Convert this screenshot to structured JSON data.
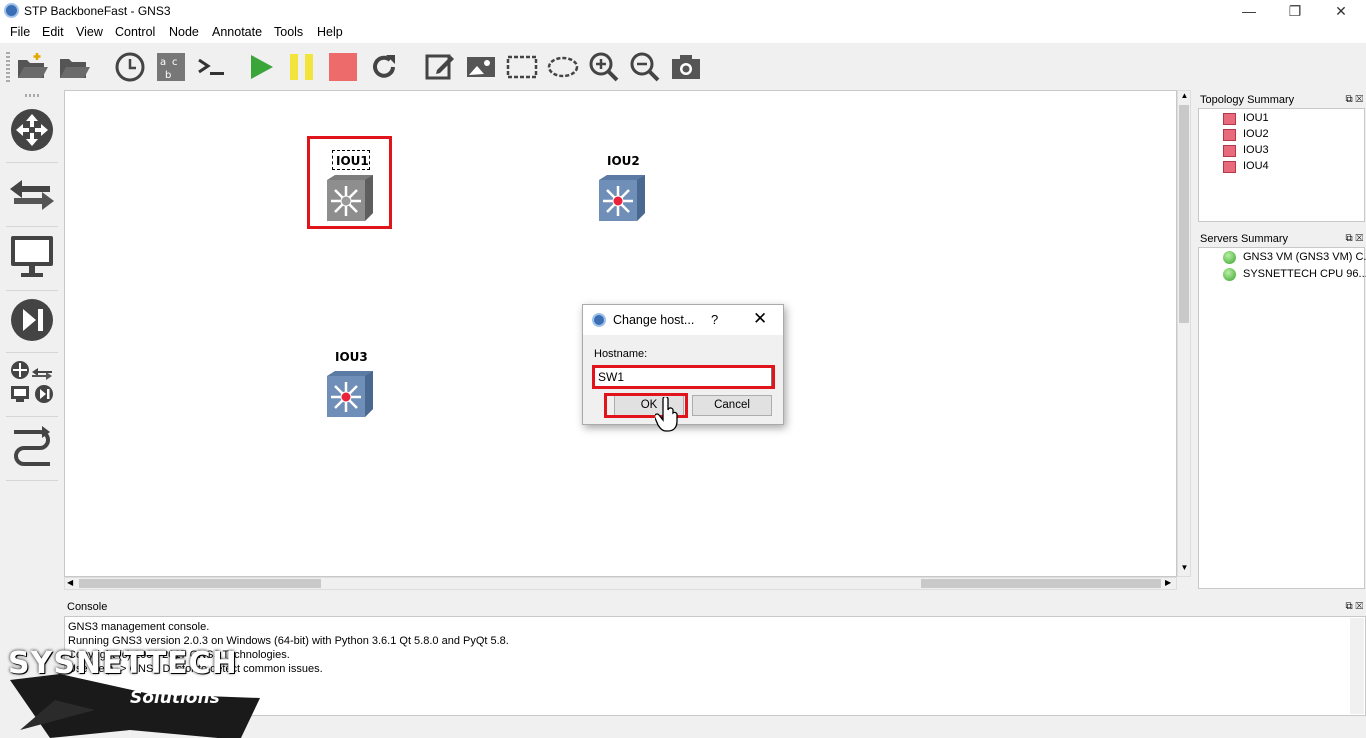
{
  "window": {
    "title": "STP BackboneFast - GNS3",
    "min": "—",
    "restore": "❐",
    "close": "✕"
  },
  "menu": [
    "File",
    "Edit",
    "View",
    "Control",
    "Node",
    "Annotate",
    "Tools",
    "Help"
  ],
  "toolbar": [
    "open-folder-icon",
    "folder-icon",
    "clock-icon",
    "abc-label-icon",
    "console-icon",
    "play-icon",
    "pause-icon",
    "stop-icon",
    "reload-icon",
    "edit-note-icon",
    "image-icon",
    "rectangle-icon",
    "ellipse-icon",
    "zoom-in-icon",
    "zoom-out-icon",
    "camera-icon"
  ],
  "nodes": [
    {
      "label": "IOU1"
    },
    {
      "label": "IOU2"
    },
    {
      "label": "IOU3"
    }
  ],
  "dialog": {
    "title": "Change host...",
    "help": "?",
    "close": "✕",
    "label": "Hostname:",
    "value": "SW1",
    "ok": "OK",
    "cancel": "Cancel"
  },
  "topology": {
    "title": "Topology Summary",
    "items": [
      "IOU1",
      "IOU2",
      "IOU3",
      "IOU4"
    ]
  },
  "servers": {
    "title": "Servers Summary",
    "items": [
      "GNS3 VM (GNS3 VM) C...",
      "SYSNETTECH CPU 96...."
    ]
  },
  "console": {
    "title": "Console",
    "lines": [
      "GNS3 management console.",
      "Running GNS3 version 2.0.3 on Windows (64-bit) with Python 3.6.1 Qt 5.8.0 and PyQt 5.8.",
      "Copyright (c) 2006-2017 GNS3 Technologies.",
      "Use Help -> GNS3 Doctor to detect common issues."
    ]
  },
  "watermark": {
    "brand": "SYSNETTECH",
    "sub": "Solutions"
  },
  "colors": {
    "highlight": "#e2141b",
    "router_blue": "#6f8fb8",
    "status_green": "#37a32a"
  }
}
